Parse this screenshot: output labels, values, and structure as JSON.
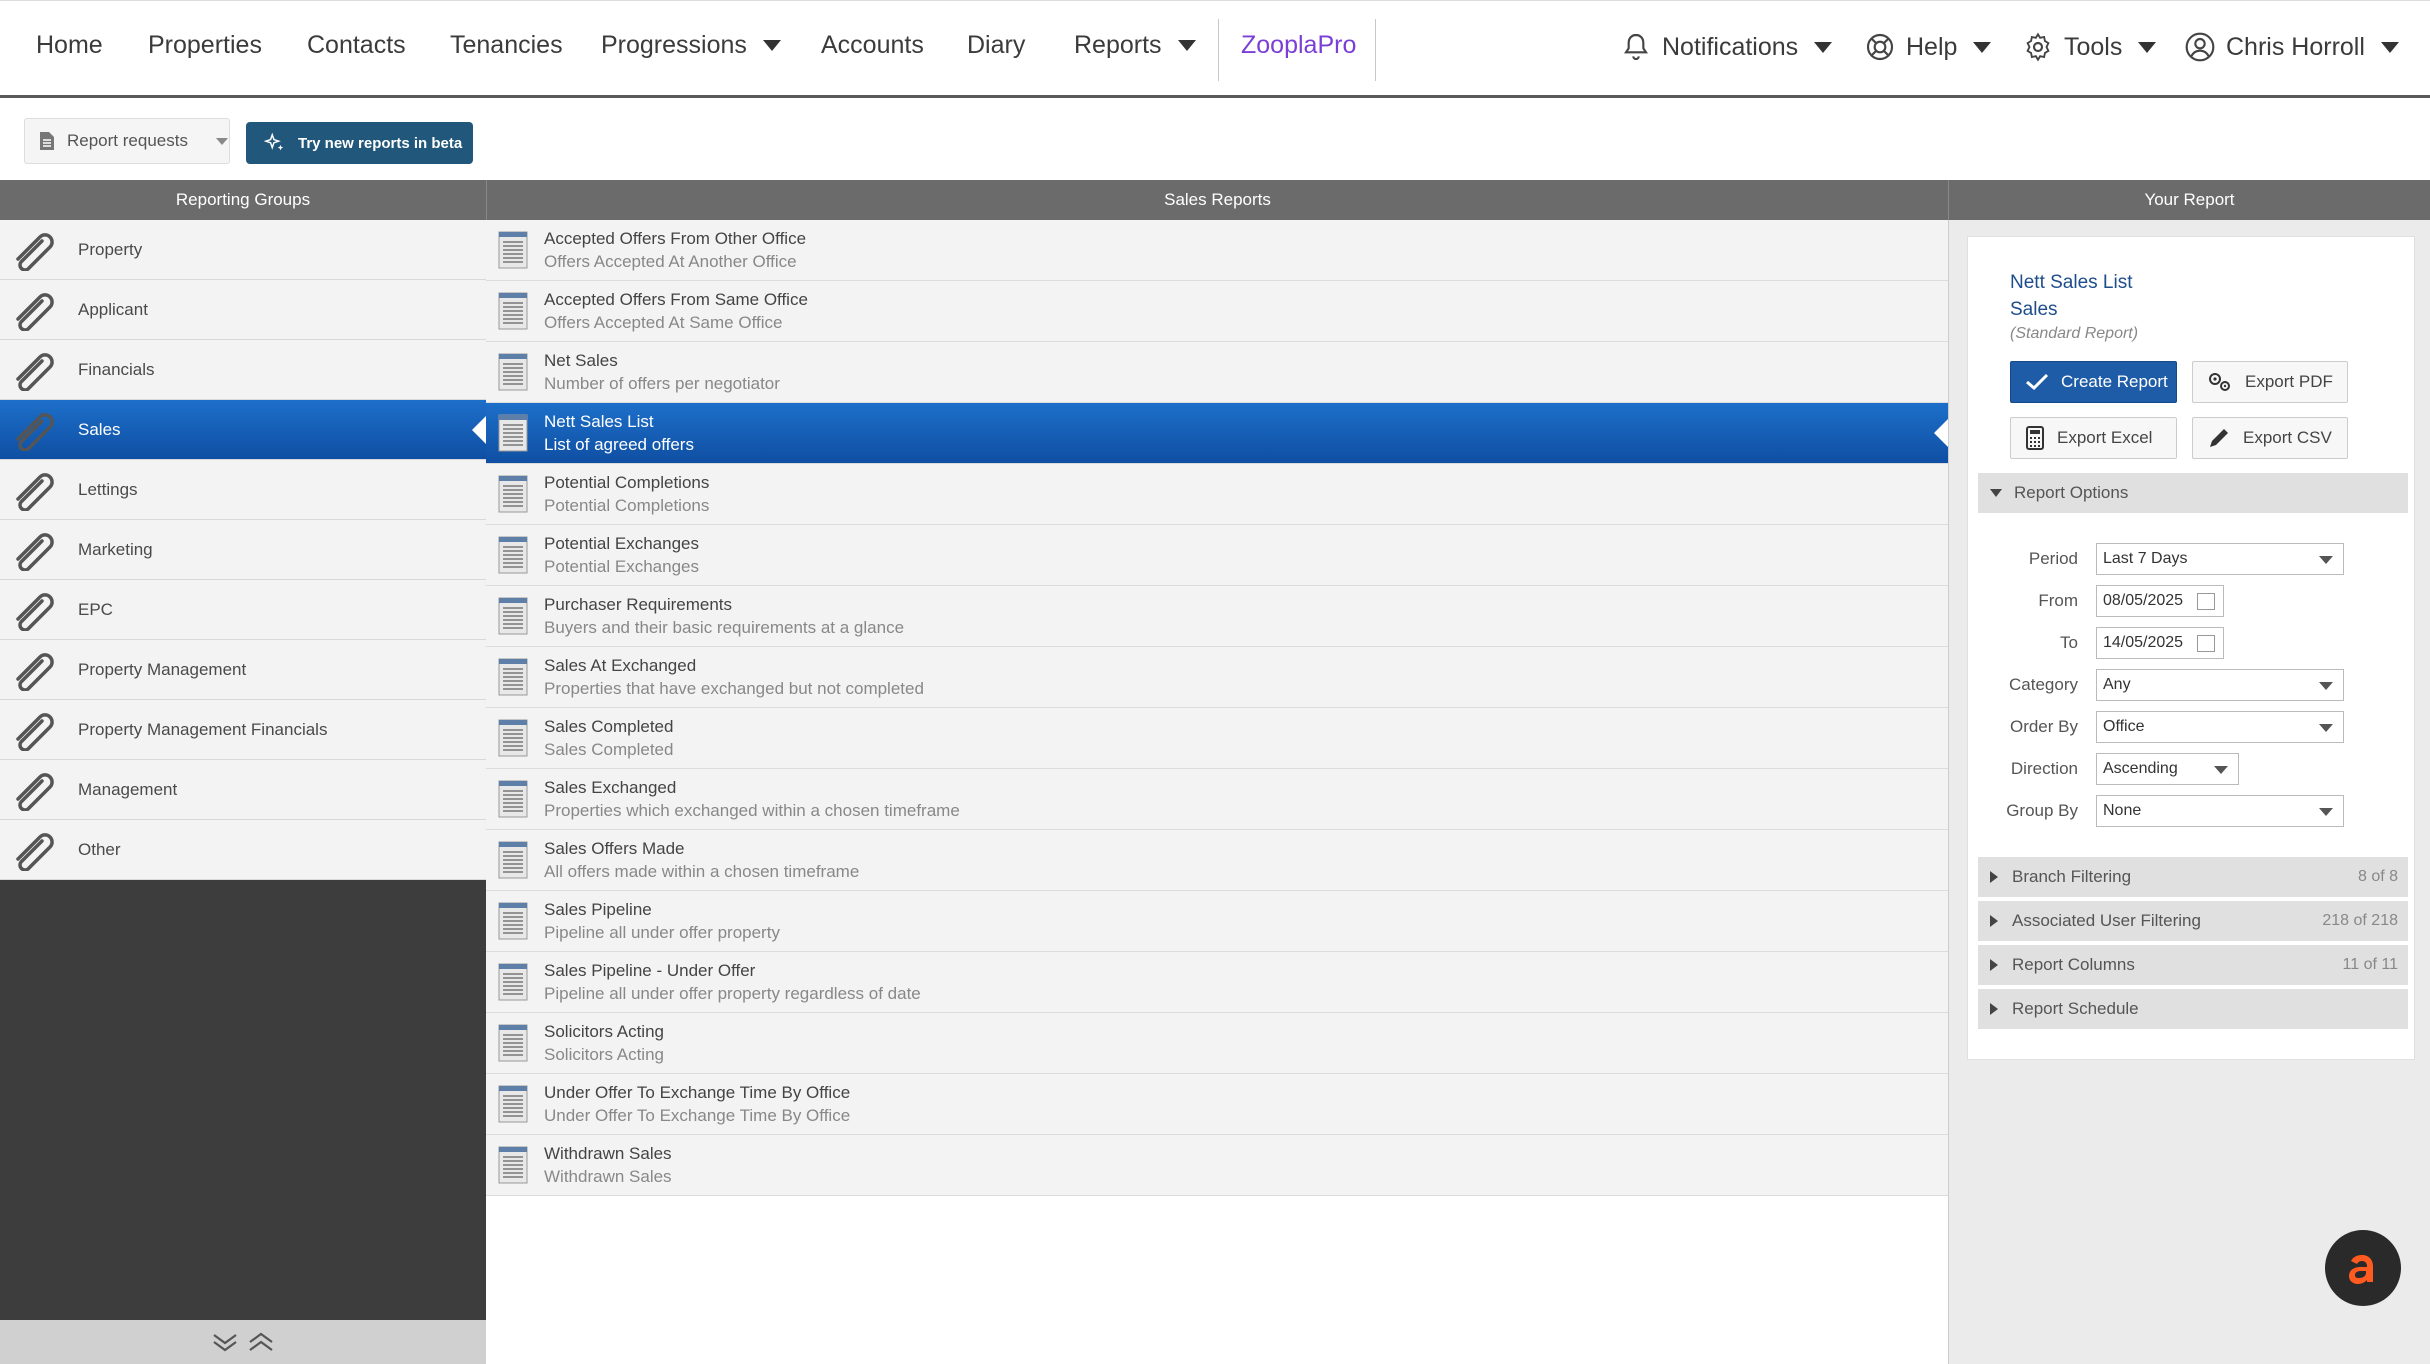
{
  "nav": {
    "home": "Home",
    "properties": "Properties",
    "contacts": "Contacts",
    "tenancies": "Tenancies",
    "progressions": "Progressions",
    "accounts": "Accounts",
    "diary": "Diary",
    "reports": "Reports",
    "zooplapro": "ZooplaPro",
    "notifications": "Notifications",
    "help": "Help",
    "tools": "Tools",
    "user": "Chris Horroll",
    "accent_color": "#7b3fd6"
  },
  "toolbar": {
    "report_requests": "Report requests",
    "beta_button": "Try new reports in beta"
  },
  "headers": {
    "groups": "Reporting Groups",
    "reports": "Sales Reports",
    "your_report": "Your Report"
  },
  "groups": [
    {
      "label": "Property"
    },
    {
      "label": "Applicant"
    },
    {
      "label": "Financials"
    },
    {
      "label": "Sales"
    },
    {
      "label": "Lettings"
    },
    {
      "label": "Marketing"
    },
    {
      "label": "EPC"
    },
    {
      "label": "Property Management"
    },
    {
      "label": "Property Management Financials"
    },
    {
      "label": "Management"
    },
    {
      "label": "Other"
    }
  ],
  "active_group": "Sales",
  "reports": [
    {
      "title": "Accepted Offers From Other Office",
      "desc": "Offers Accepted At Another Office"
    },
    {
      "title": "Accepted Offers From Same Office",
      "desc": "Offers Accepted At Same Office"
    },
    {
      "title": "Net Sales",
      "desc": "Number of offers per negotiator"
    },
    {
      "title": "Nett Sales List",
      "desc": "List of agreed offers"
    },
    {
      "title": "Potential Completions",
      "desc": "Potential Completions"
    },
    {
      "title": "Potential Exchanges",
      "desc": "Potential Exchanges"
    },
    {
      "title": "Purchaser Requirements",
      "desc": "Buyers and their basic requirements at a glance"
    },
    {
      "title": "Sales At Exchanged",
      "desc": "Properties that have exchanged but not completed"
    },
    {
      "title": "Sales Completed",
      "desc": "Sales Completed"
    },
    {
      "title": "Sales Exchanged",
      "desc": "Properties which exchanged within a chosen timeframe"
    },
    {
      "title": "Sales Offers Made",
      "desc": "All offers made within a chosen timeframe"
    },
    {
      "title": "Sales Pipeline",
      "desc": "Pipeline all under offer property"
    },
    {
      "title": "Sales Pipeline - Under Offer",
      "desc": "Pipeline all under offer property regardless of date"
    },
    {
      "title": "Solicitors Acting",
      "desc": "Solicitors Acting"
    },
    {
      "title": "Under Offer To Exchange Time By Office",
      "desc": "Under Offer To Exchange Time By Office"
    },
    {
      "title": "Withdrawn Sales",
      "desc": "Withdrawn Sales"
    }
  ],
  "active_report": "Nett Sales List",
  "your_report": {
    "name": "Nett Sales List",
    "group": "Sales",
    "type": "(Standard Report)",
    "create": "Create Report",
    "export_pdf": "Export PDF",
    "export_excel": "Export Excel",
    "export_csv": "Export CSV",
    "options_title": "Report Options",
    "options": {
      "period_label": "Period",
      "period": "Last 7 Days",
      "from_label": "From",
      "from": "08/05/2025",
      "to_label": "To",
      "to": "14/05/2025",
      "category_label": "Category",
      "category": "Any",
      "order_label": "Order By",
      "order": "Office",
      "direction_label": "Direction",
      "direction": "Ascending",
      "group_label": "Group By",
      "group": "None"
    },
    "sections": [
      {
        "label": "Branch Filtering",
        "count": "8 of 8"
      },
      {
        "label": "Associated User Filtering",
        "count": "218 of 218"
      },
      {
        "label": "Report Columns",
        "count": "11 of 11"
      },
      {
        "label": "Report Schedule",
        "count": ""
      }
    ]
  },
  "colors": {
    "active_blue": "#1d6fc9",
    "panel_header": "#6b6b6b",
    "fab_letter": "#ff5a1f"
  }
}
